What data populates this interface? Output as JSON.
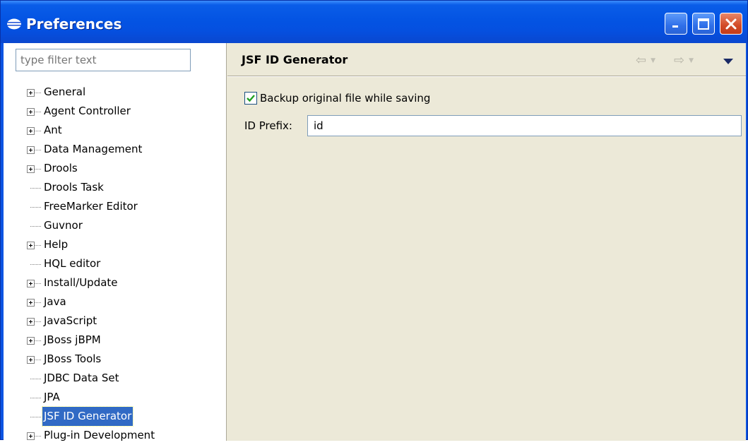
{
  "window": {
    "title": "Preferences",
    "controls": [
      "minimize",
      "maximize",
      "close"
    ]
  },
  "sidebar": {
    "filter": {
      "value": "",
      "placeholder": "type filter text"
    },
    "tree": [
      {
        "label": "General",
        "expandable": true
      },
      {
        "label": "Agent Controller",
        "expandable": true
      },
      {
        "label": "Ant",
        "expandable": true
      },
      {
        "label": "Data Management",
        "expandable": true
      },
      {
        "label": "Drools",
        "expandable": true
      },
      {
        "label": "Drools Task",
        "expandable": false
      },
      {
        "label": "FreeMarker Editor",
        "expandable": false
      },
      {
        "label": "Guvnor",
        "expandable": false
      },
      {
        "label": "Help",
        "expandable": true
      },
      {
        "label": "HQL editor",
        "expandable": false
      },
      {
        "label": "Install/Update",
        "expandable": true
      },
      {
        "label": "Java",
        "expandable": true
      },
      {
        "label": "JavaScript",
        "expandable": true
      },
      {
        "label": "JBoss jBPM",
        "expandable": true
      },
      {
        "label": "JBoss Tools",
        "expandable": true
      },
      {
        "label": "JDBC Data Set",
        "expandable": false
      },
      {
        "label": "JPA",
        "expandable": false
      },
      {
        "label": "JSF ID Generator",
        "expandable": false,
        "selected": true
      },
      {
        "label": "Plug-in Development",
        "expandable": true
      }
    ]
  },
  "main": {
    "title": "JSF ID Generator",
    "backup_checkbox": {
      "label": "Backup original file while saving",
      "checked": true
    },
    "id_prefix": {
      "label": "ID Prefix:",
      "value": "id"
    }
  },
  "colors": {
    "titlebar": "#0454e3",
    "selection": "#316ac5",
    "dialog_bg": "#ece9d8",
    "close_button": "#d24a26"
  }
}
